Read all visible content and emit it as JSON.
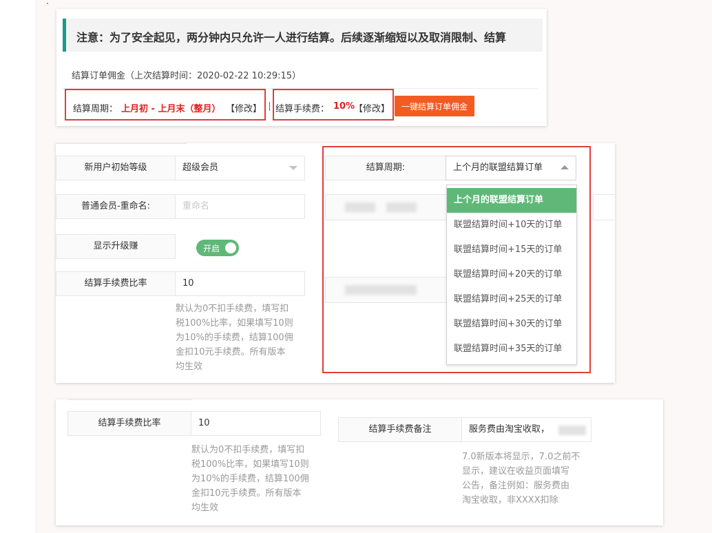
{
  "notice": {
    "text": "注意：为了安全起见，两分钟内只允许一人进行结算。后续逐渐缩短以及取消限制、结算"
  },
  "settle": {
    "title": "结算订单佣金（上次结算时间：2020-02-22 10:29:15）",
    "period_label": "结算周期：",
    "period_value": "上月初 - 上月末（整月）",
    "period_edit": "【修改】",
    "fee_label": "结算手续费：",
    "fee_value": "10%",
    "fee_edit": "【修改】",
    "button_label": "一键结算订单佣金"
  },
  "form1": {
    "init_level_label": "新用户初始等级",
    "init_level_value": "超级会员",
    "rename_label": "普通会员-重命名:",
    "rename_placeholder": "重命名",
    "show_upgrade_label": "显示升级赚",
    "toggle_label": "开启",
    "fee_ratio_label": "结算手续费比率",
    "fee_ratio_value": "10",
    "fee_help": [
      "默认为0不扣手续费，填写扣",
      "税100%比率，如果填写10则",
      "为10%的手续费，结算100佣",
      "金扣10元手续费。所有版本",
      "均生效"
    ],
    "period_label": "结算周期:",
    "period_value": "上个月的联盟结算订单",
    "period_options": [
      "上个月的联盟结算订单",
      "联盟结算时间+10天的订单",
      "联盟结算时间+15天的订单",
      "联盟结算时间+20天的订单",
      "联盟结算时间+25天的订单",
      "联盟结算时间+30天的订单",
      "联盟结算时间+35天的订单"
    ]
  },
  "form2": {
    "fee_ratio_label": "结算手续费比率",
    "fee_ratio_value": "10",
    "fee_help": [
      "默认为0不扣手续费，填写扣",
      "税100%比率，如果填写10则",
      "为10%的手续费，结算100佣",
      "金扣10元手续费。所有版本",
      "均生效"
    ],
    "fee_note_label": "结算手续费备注",
    "fee_note_value": "服务费由淘宝收取，",
    "note_help": [
      "7.0新版本将显示，7.0之前不",
      "显示，建议在收益页面填写",
      "公告，备注例如：服务费由",
      "淘宝收取，非XXXX扣除"
    ]
  },
  "colors": {
    "accent_green": "#5fb878",
    "notice_border": "#1a9b86",
    "highlight_red": "#e23b3b",
    "button_orange": "#f25c23"
  }
}
